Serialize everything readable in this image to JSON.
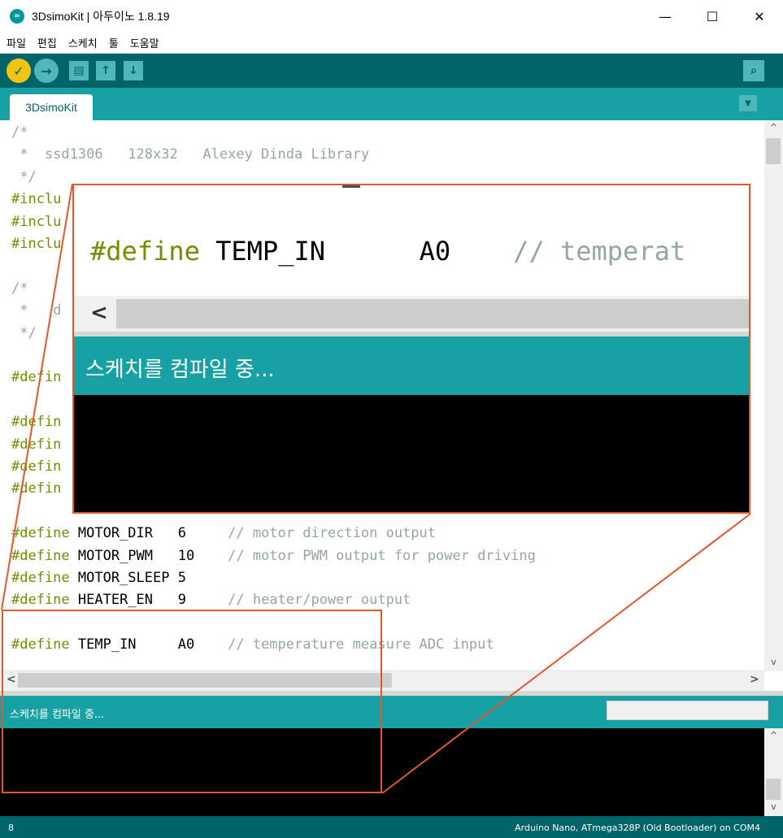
{
  "window": {
    "title": "3DsimoKit | 아두이노 1.8.19",
    "icon_label": "∞",
    "minimize": "—",
    "maximize": "☐",
    "close": "✕"
  },
  "menu": [
    "파일",
    "편집",
    "스케치",
    "툴",
    "도움말"
  ],
  "toolbar": {
    "verify_icon": "✓",
    "upload_icon": "→",
    "new_icon": "▤",
    "open_icon": "↑",
    "save_icon": "↓",
    "serial_icon": "⌕"
  },
  "tabs": [
    {
      "label": "3DsimoKit"
    }
  ],
  "tab_menu_icon": "▼",
  "code": [
    {
      "parts": [
        {
          "t": "/*",
          "c": "comment"
        }
      ]
    },
    {
      "parts": [
        {
          "t": " *  ssd1306   128x32   Alexey Dinda Library",
          "c": "comment"
        }
      ]
    },
    {
      "parts": [
        {
          "t": " */",
          "c": "comment"
        }
      ]
    },
    {
      "parts": [
        {
          "t": "#inclu",
          "c": "kw"
        }
      ]
    },
    {
      "parts": [
        {
          "t": "#inclu",
          "c": "kw"
        }
      ]
    },
    {
      "parts": [
        {
          "t": "#inclu",
          "c": "kw"
        }
      ]
    },
    {
      "parts": []
    },
    {
      "parts": [
        {
          "t": "/*",
          "c": "comment"
        }
      ]
    },
    {
      "parts": [
        {
          "t": " *   d",
          "c": "comment"
        }
      ]
    },
    {
      "parts": [
        {
          "t": " */",
          "c": "comment"
        }
      ]
    },
    {
      "parts": []
    },
    {
      "parts": [
        {
          "t": "#defin",
          "c": "kw"
        }
      ]
    },
    {
      "parts": []
    },
    {
      "parts": [
        {
          "t": "#defin",
          "c": "kw"
        }
      ]
    },
    {
      "parts": [
        {
          "t": "#defin",
          "c": "kw"
        }
      ]
    },
    {
      "parts": [
        {
          "t": "#defin",
          "c": "kw"
        }
      ]
    },
    {
      "parts": [
        {
          "t": "#defin",
          "c": "kw"
        }
      ]
    },
    {
      "parts": []
    },
    {
      "parts": [
        {
          "t": "#define",
          "c": "kw"
        },
        {
          "t": " MOTOR_DIR   6     ",
          "c": "id"
        },
        {
          "t": "// motor direction output",
          "c": "comment"
        }
      ]
    },
    {
      "parts": [
        {
          "t": "#define",
          "c": "kw"
        },
        {
          "t": " MOTOR_PWM   10    ",
          "c": "id"
        },
        {
          "t": "// motor PWM output for power driving",
          "c": "comment"
        }
      ]
    },
    {
      "parts": [
        {
          "t": "#define",
          "c": "kw"
        },
        {
          "t": " MOTOR_SLEEP 5",
          "c": "id"
        }
      ]
    },
    {
      "parts": [
        {
          "t": "#define",
          "c": "kw"
        },
        {
          "t": " HEATER_EN   9     ",
          "c": "id"
        },
        {
          "t": "// heater/power output",
          "c": "comment"
        }
      ]
    },
    {
      "parts": []
    },
    {
      "parts": [
        {
          "t": "#define",
          "c": "kw"
        },
        {
          "t": " TEMP_IN     A0    ",
          "c": "id"
        },
        {
          "t": "// temperature measure ADC input",
          "c": "comment"
        }
      ]
    }
  ],
  "zoom": {
    "code_parts": [
      {
        "t": "#define",
        "c": "kw"
      },
      {
        "t": " TEMP_IN      A0    ",
        "c": "id"
      },
      {
        "t": "// temperat",
        "c": "comment"
      }
    ],
    "status": "스케치를 컴파일 중..."
  },
  "scroll": {
    "left": "<",
    "right": ">",
    "up": "^",
    "down": "v"
  },
  "status": {
    "message": "스케치를 컴파일 중..."
  },
  "footer": {
    "line": "8",
    "board": "Arduino Nano, ATmega328P (Old Bootloader) on COM4"
  },
  "colors": {
    "teal_dark": "#006468",
    "teal": "#17a1a5",
    "verify_yellow": "#f1c40f",
    "accent_orange": "#e1592a"
  }
}
